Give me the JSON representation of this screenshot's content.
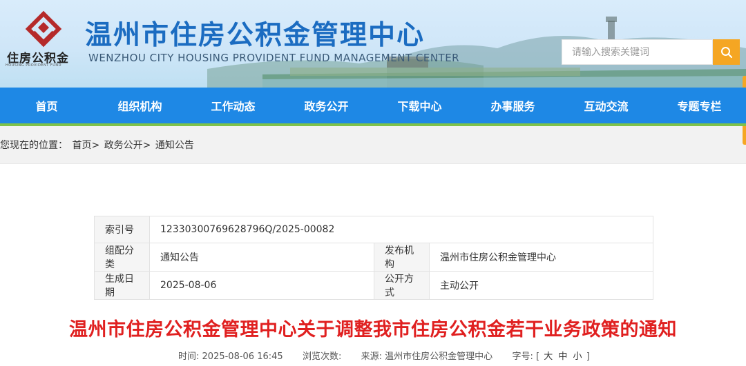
{
  "header": {
    "site_title": "温州市住房公积金管理中心",
    "site_subtitle": "WENZHOU CITY HOUSING PROVIDENT FUND MANAGEMENT CENTER",
    "logo_cn": "住房公积金",
    "logo_en": "HOUSING PROVIDENT FUND",
    "search_placeholder": "请输入搜索关键词",
    "colors": {
      "title": "#1b6cc1",
      "search_button": "#f5a623",
      "logo_red": "#b52a2a"
    }
  },
  "nav": {
    "color": "#1e88e5",
    "items": [
      {
        "label": "首页"
      },
      {
        "label": "组织机构"
      },
      {
        "label": "工作动态"
      },
      {
        "label": "政务公开"
      },
      {
        "label": "下载中心"
      },
      {
        "label": "办事服务"
      },
      {
        "label": "互动交流"
      },
      {
        "label": "专题专栏"
      }
    ]
  },
  "breadcrumb": {
    "prefix": "您现在的位置：",
    "items": [
      "首页>",
      "政务公开>",
      "通知公告"
    ]
  },
  "meta": {
    "index_label": "索引号",
    "index_value": "12330300769628796Q/2025-00082",
    "category_label": "组配分类",
    "category_value": "通知公告",
    "publisher_label": "发布机构",
    "publisher_value": "温州市住房公积金管理中心",
    "date_label": "生成日期",
    "date_value": "2025-08-06",
    "disclosure_label": "公开方式",
    "disclosure_value": "主动公开"
  },
  "article": {
    "title": "温州市住房公积金管理中心关于调整我市住房公积金若干业务政策的通知",
    "title_color": "#e02020",
    "time_label": "时间:",
    "time_value": "2025-08-06 16:45",
    "views_label": "浏览次数:",
    "source_label": "来源:",
    "source_value": "温州市住房公积金管理中心",
    "font_label": "字号:",
    "font_open": "[",
    "font_large": "大",
    "font_medium": "中",
    "font_small": "小",
    "font_close": "]"
  }
}
